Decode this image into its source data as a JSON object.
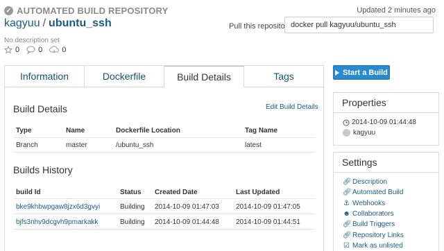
{
  "header": {
    "auto_label": "AUTOMATED BUILD REPOSITORY",
    "updated": "Updated 2 minutes ago",
    "owner": "kagyuu",
    "separator": "/",
    "repo": "ubuntu_ssh",
    "pull_label": "Pull this repository",
    "pull_command": "docker pull kagyuu/ubuntu_ssh",
    "description": "No description set",
    "stars": "0",
    "comments": "0",
    "downloads": "0"
  },
  "tabs": [
    {
      "label": "Information"
    },
    {
      "label": "Dockerfile"
    },
    {
      "label": "Build Details"
    },
    {
      "label": "Tags"
    }
  ],
  "build_details": {
    "title": "Build Details",
    "edit_link": "Edit Build Details",
    "headers": [
      "Type",
      "Name",
      "Dockerfile Location",
      "Tag Name"
    ],
    "rows": [
      [
        "Branch",
        "master",
        "/ubuntu_ssh",
        "latest"
      ]
    ]
  },
  "builds_history": {
    "title": "Builds History",
    "headers": [
      "build Id",
      "Status",
      "Created Date",
      "Last Updated"
    ],
    "rows": [
      [
        "bke9khbwpgaw8jzx6d3gvyi",
        "Building",
        "2014-10-09 01:47:03",
        "2014-10-09 01:47:05"
      ],
      [
        "bjfs3nhv9dcgvh9pmarkakk",
        "Building",
        "2014-10-09 01:44:48",
        "2014-10-09 01:44:51"
      ]
    ]
  },
  "sidebar": {
    "start_button": "Start a Build",
    "properties_title": "Properties",
    "properties_date": "2014-10-09 01:44:48",
    "properties_user": "kagyuu",
    "settings_title": "Settings",
    "settings_links": [
      {
        "label": "Description",
        "icon": "link-icon"
      },
      {
        "label": "Automated Build",
        "icon": "link-icon"
      },
      {
        "label": "Webhooks",
        "icon": "anchor-icon"
      },
      {
        "label": "Collaborators",
        "icon": "users-icon"
      },
      {
        "label": "Build Triggers",
        "icon": "link-icon"
      },
      {
        "label": "Repository Links",
        "icon": "link-icon"
      },
      {
        "label": "Mark as unlisted",
        "icon": "checkbox-icon"
      }
    ]
  }
}
